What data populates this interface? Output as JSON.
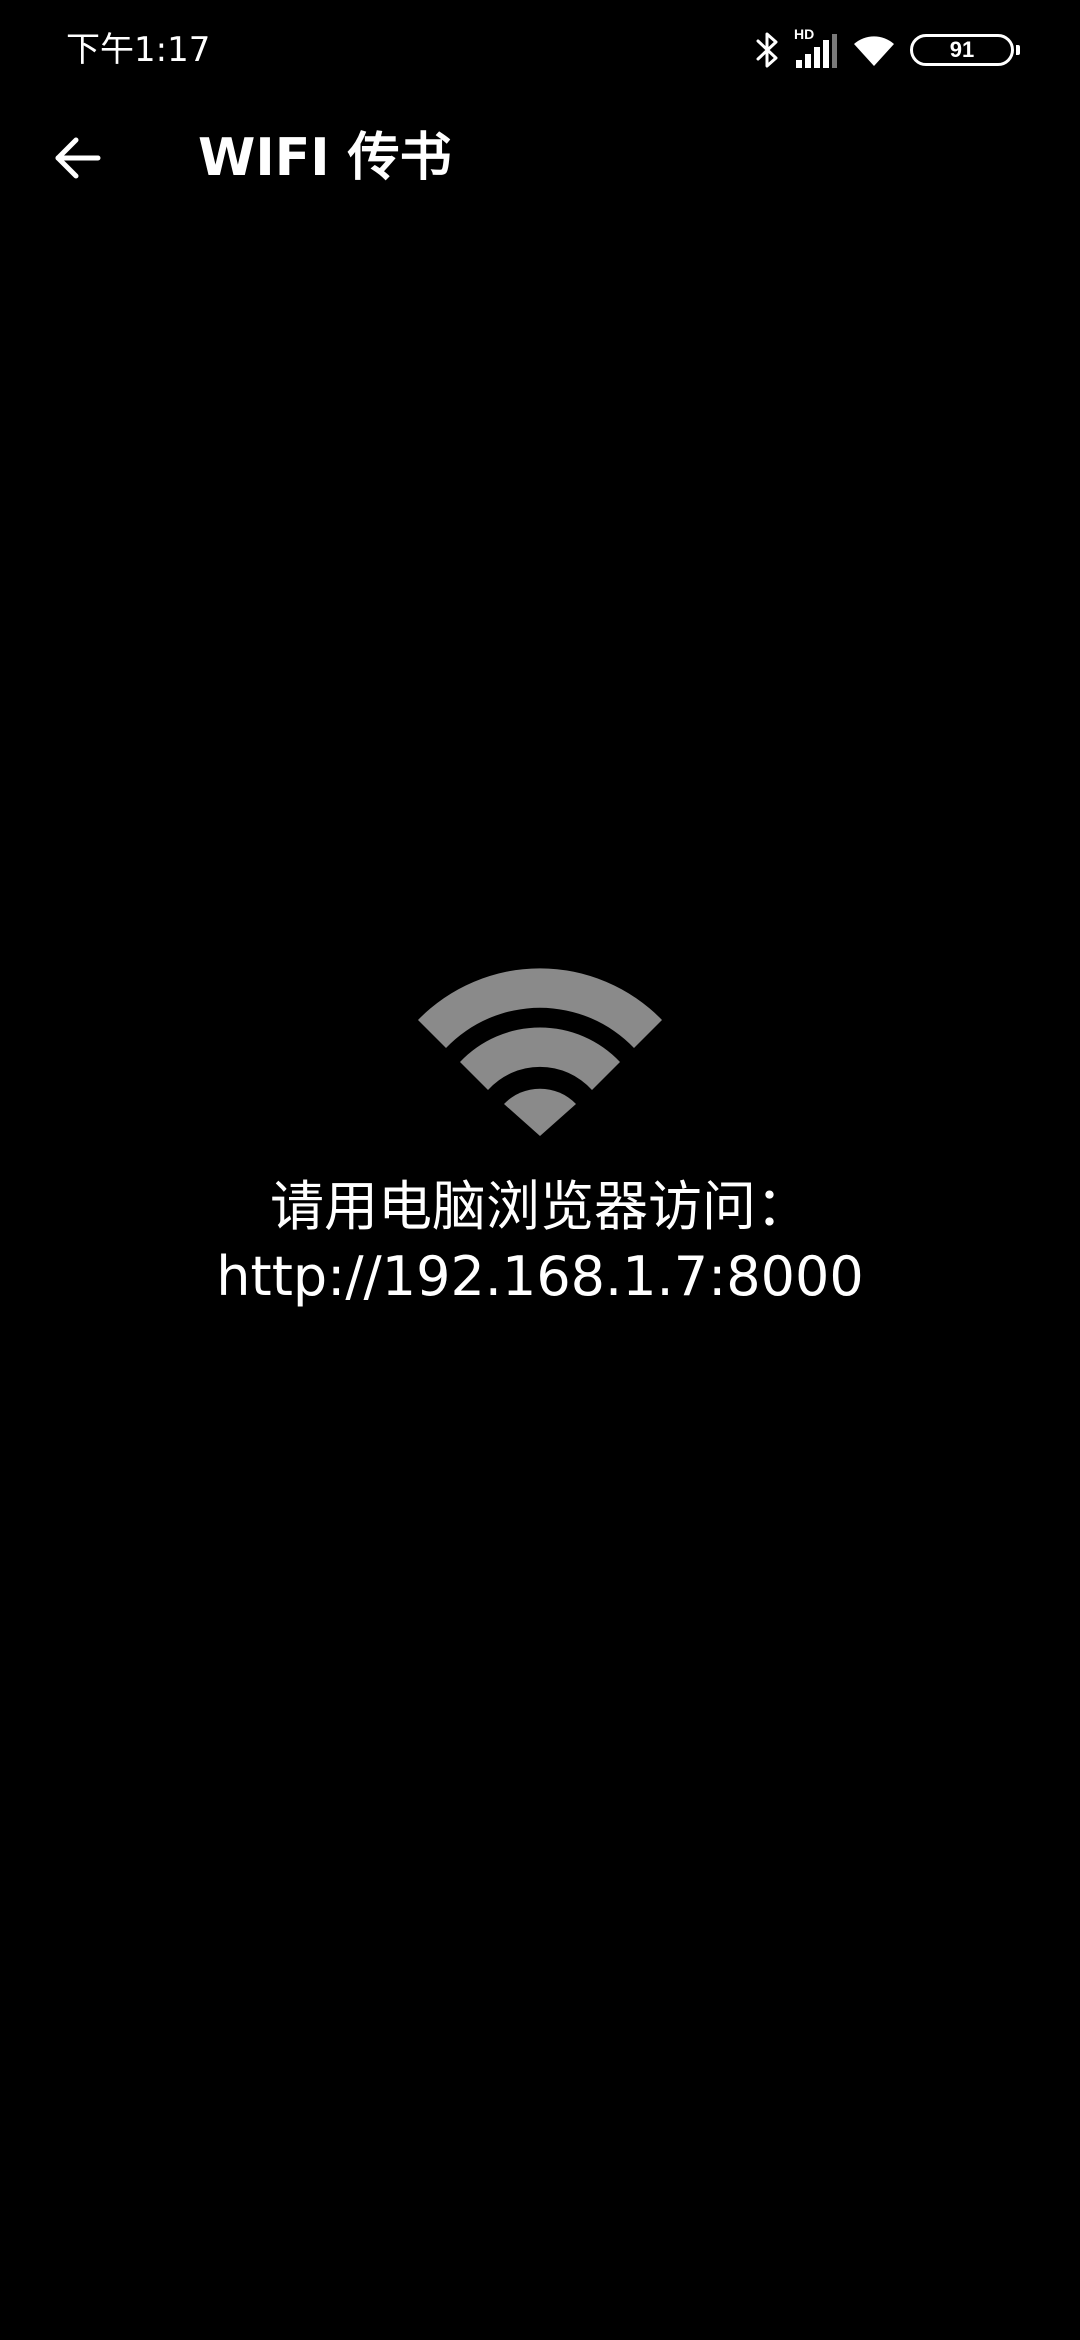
{
  "status_bar": {
    "time": "下午1:17",
    "network_label": "HD",
    "battery_level": "91",
    "icons": [
      "bluetooth-icon",
      "signal-icon",
      "wifi-icon",
      "battery-icon"
    ]
  },
  "app_bar": {
    "back_icon": "arrow-left-icon",
    "title": "WIFI 传书"
  },
  "content": {
    "graphic_icon": "wifi-icon",
    "graphic_color": "#8a8a8a",
    "instruction": "请用电脑浏览器访问：",
    "address": "http://192.168.1.7:8000"
  },
  "colors": {
    "background": "#000000",
    "text": "#ffffff"
  }
}
